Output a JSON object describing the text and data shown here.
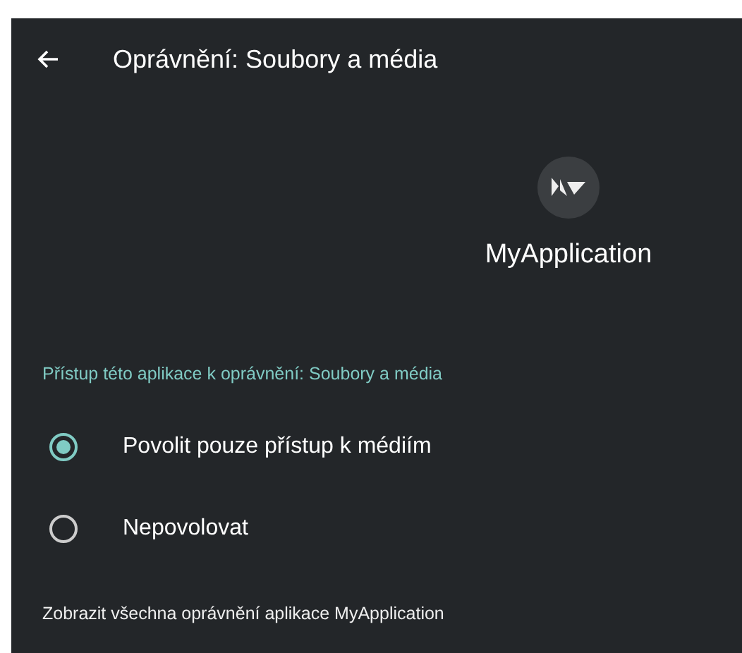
{
  "app_bar": {
    "title": "Oprávnění: Soubory a média"
  },
  "app": {
    "name": "MyApplication"
  },
  "section": {
    "title": "Přístup této aplikace k oprávnění: Soubory a média"
  },
  "options": [
    {
      "label": "Povolit pouze přístup k médiím",
      "selected": true
    },
    {
      "label": "Nepovolovat",
      "selected": false
    }
  ],
  "footer_link": "Zobrazit všechna oprávnění aplikace MyApplication"
}
